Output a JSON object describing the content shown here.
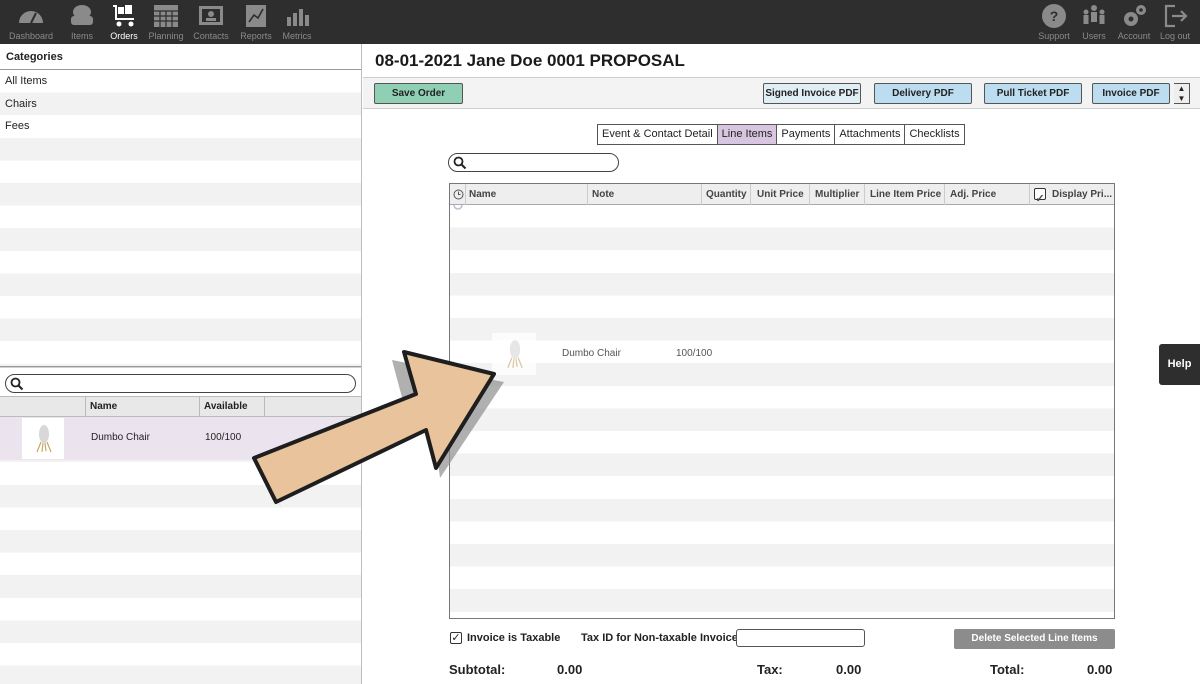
{
  "nav": {
    "left": [
      {
        "label": "Dashboard",
        "icon": "gauge-icon"
      },
      {
        "label": "Items",
        "icon": "armchair-icon"
      },
      {
        "label": "Orders",
        "icon": "cart-icon",
        "active": true
      },
      {
        "label": "Planning",
        "icon": "calendar-icon"
      },
      {
        "label": "Contacts",
        "icon": "address-card-icon"
      },
      {
        "label": "Reports",
        "icon": "line-chart-icon"
      },
      {
        "label": "Metrics",
        "icon": "bar-chart-icon"
      }
    ],
    "right": [
      {
        "label": "Support",
        "icon": "question-icon"
      },
      {
        "label": "Users",
        "icon": "users-icon"
      },
      {
        "label": "Account",
        "icon": "gears-icon"
      },
      {
        "label": "Log out",
        "icon": "logout-icon"
      }
    ]
  },
  "categories": {
    "header": "Categories",
    "items": [
      "All Items",
      "Chairs",
      "Fees"
    ]
  },
  "inventory": {
    "columns": [
      "Name",
      "Available"
    ],
    "rows": [
      {
        "name": "Dumbo Chair",
        "available": "100/100",
        "thumb": "chair-thumbnail"
      }
    ]
  },
  "order": {
    "title": "08-01-2021 Jane Doe 0001 PROPOSAL",
    "toolbar": {
      "save": "Save Order",
      "signed_invoice": "Signed Invoice PDF",
      "delivery": "Delivery PDF",
      "pull_ticket": "Pull Ticket PDF",
      "invoice": "Invoice PDF"
    },
    "tabs": [
      {
        "label": "Event & Contact Detail"
      },
      {
        "label": "Line Items",
        "active": true
      },
      {
        "label": "Payments"
      },
      {
        "label": "Attachments"
      },
      {
        "label": "Checklists"
      }
    ],
    "line_columns": [
      "Name",
      "Note",
      "Quantity",
      "Unit Price",
      "Multiplier",
      "Line Item Price",
      "Adj. Price",
      "Display Pri..."
    ],
    "drag_item": {
      "name": "Dumbo Chair",
      "available": "100/100"
    },
    "taxable_label": "Invoice is Taxable",
    "tax_id_label": "Tax ID for Non-taxable Invoice:",
    "delete_label": "Delete Selected Line Items",
    "subtotal_label": "Subtotal:",
    "subtotal": "0.00",
    "tax_label": "Tax:",
    "tax": "0.00",
    "total_label": "Total:",
    "total": "0.00"
  },
  "help": "Help",
  "colors": {
    "nav_bg": "#2e2e2e",
    "save_btn": "#8fcfb4",
    "pdf_btn": "#bcdcef",
    "active_tab": "#d8c6e0",
    "arrow_fill": "#e8c39c"
  }
}
